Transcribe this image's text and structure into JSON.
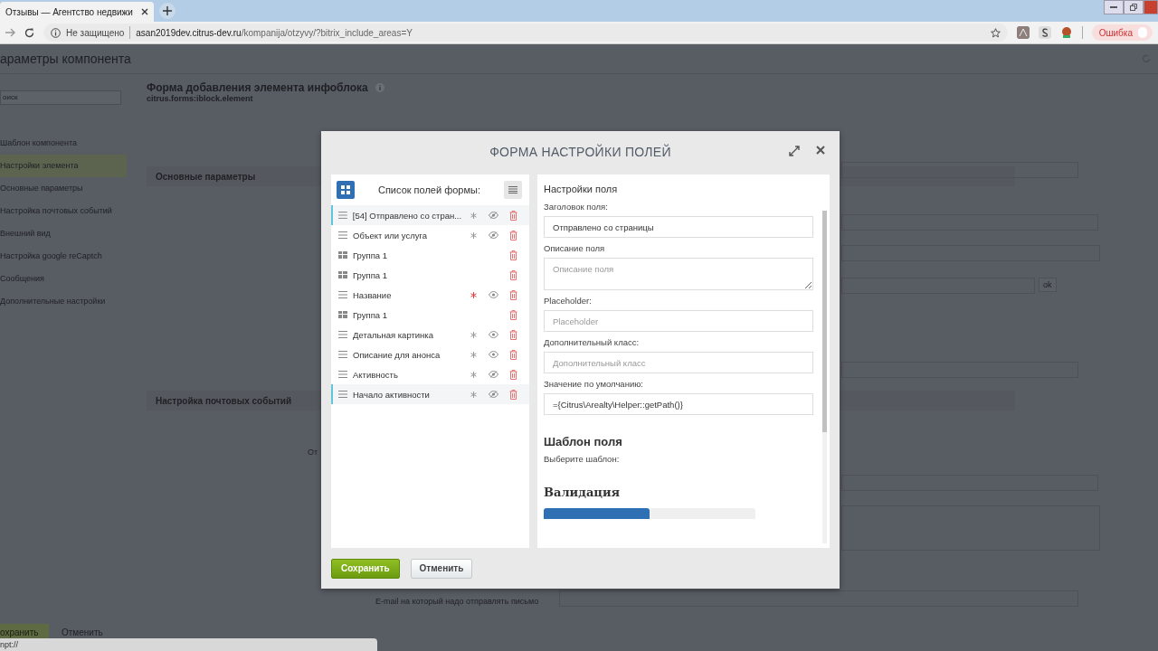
{
  "browser": {
    "tab_title": "Отзывы — Агентство недвижи",
    "url_host": "asan2019dev.citrus-dev.ru",
    "url_path": "/kompanija/otzyvy/?bitrix_include_areas=Y",
    "security_label": "Не защищено",
    "profile_label": "Ошибка",
    "status_text": "npt://"
  },
  "page": {
    "title": "араметры компонента",
    "search": {
      "placeholder": "оиск"
    },
    "sidebar": [
      {
        "label": "Шаблон компонента",
        "selected": false
      },
      {
        "label": "Настройки элемента",
        "selected": true
      },
      {
        "label": "Основные параметры",
        "selected": false
      },
      {
        "label": "Настройка почтовых событий",
        "selected": false
      },
      {
        "label": "Внешний вид",
        "selected": false
      },
      {
        "label": "Настройка google reCaptch",
        "selected": false
      },
      {
        "label": "Сообщения",
        "selected": false
      },
      {
        "label": "Дополнительные настройки",
        "selected": false
      }
    ],
    "component_title": "Форма добавления элемента инфоблока",
    "component_code": "citrus.forms:iblock.element",
    "sections": [
      "Основные параметры",
      "Настройка почтовых событий"
    ],
    "partial_label": "От",
    "ok_label": "ok",
    "email_label": "E-mail на который надо отправлять письмо",
    "save_label": "охранить",
    "cancel_label": "Отменить"
  },
  "modal": {
    "title": "ФОРМА НАСТРОЙКИ ПОЛЕЙ",
    "list_title": "Список полей формы:",
    "fields": [
      {
        "kind": "field",
        "label": "[54] Отправлено со стран...",
        "selected": true,
        "required": false,
        "visible": false
      },
      {
        "kind": "field",
        "label": "Объект или услуга",
        "selected": false,
        "required": false,
        "visible": false
      },
      {
        "kind": "group",
        "label": "Группа 1",
        "selected": false
      },
      {
        "kind": "group",
        "label": "Группа 1",
        "selected": false
      },
      {
        "kind": "field",
        "label": "Название",
        "selected": false,
        "required": true,
        "visible": true
      },
      {
        "kind": "group",
        "label": "Группа 1",
        "selected": false
      },
      {
        "kind": "field",
        "label": "Детальная картинка",
        "selected": false,
        "required": false,
        "visible": true
      },
      {
        "kind": "field",
        "label": "Описание для анонса",
        "selected": false,
        "required": false,
        "visible": true
      },
      {
        "kind": "field",
        "label": "Активность",
        "selected": false,
        "required": false,
        "visible": false
      },
      {
        "kind": "field",
        "label": "Начало активности",
        "selected": true,
        "required": false,
        "visible": false
      }
    ],
    "settings_title": "Настройки поля",
    "settings": [
      {
        "kind": "input",
        "label": "Заголовок поля:",
        "value": "Отправлено со страницы"
      },
      {
        "kind": "textarea",
        "label": "Описание поля",
        "placeholder": "Описание поля"
      },
      {
        "kind": "input",
        "label": "Placeholder:",
        "placeholder": "Placeholder"
      },
      {
        "kind": "input",
        "label": "Дополнительный класс:",
        "placeholder": "Дополнительный класс"
      },
      {
        "kind": "input",
        "label": "Значение по умолчанию:",
        "value": "={Citrus\\Arealty\\Helper::getPath()}"
      }
    ],
    "template_title": "Шаблон поля",
    "template_label": "Выберите шаблон:",
    "validation_title": "Валидация",
    "validation_tabs": [
      {
        "selected": true
      },
      {
        "selected": false
      }
    ],
    "save_button": "Сохранить",
    "cancel_button": "Отменить"
  }
}
